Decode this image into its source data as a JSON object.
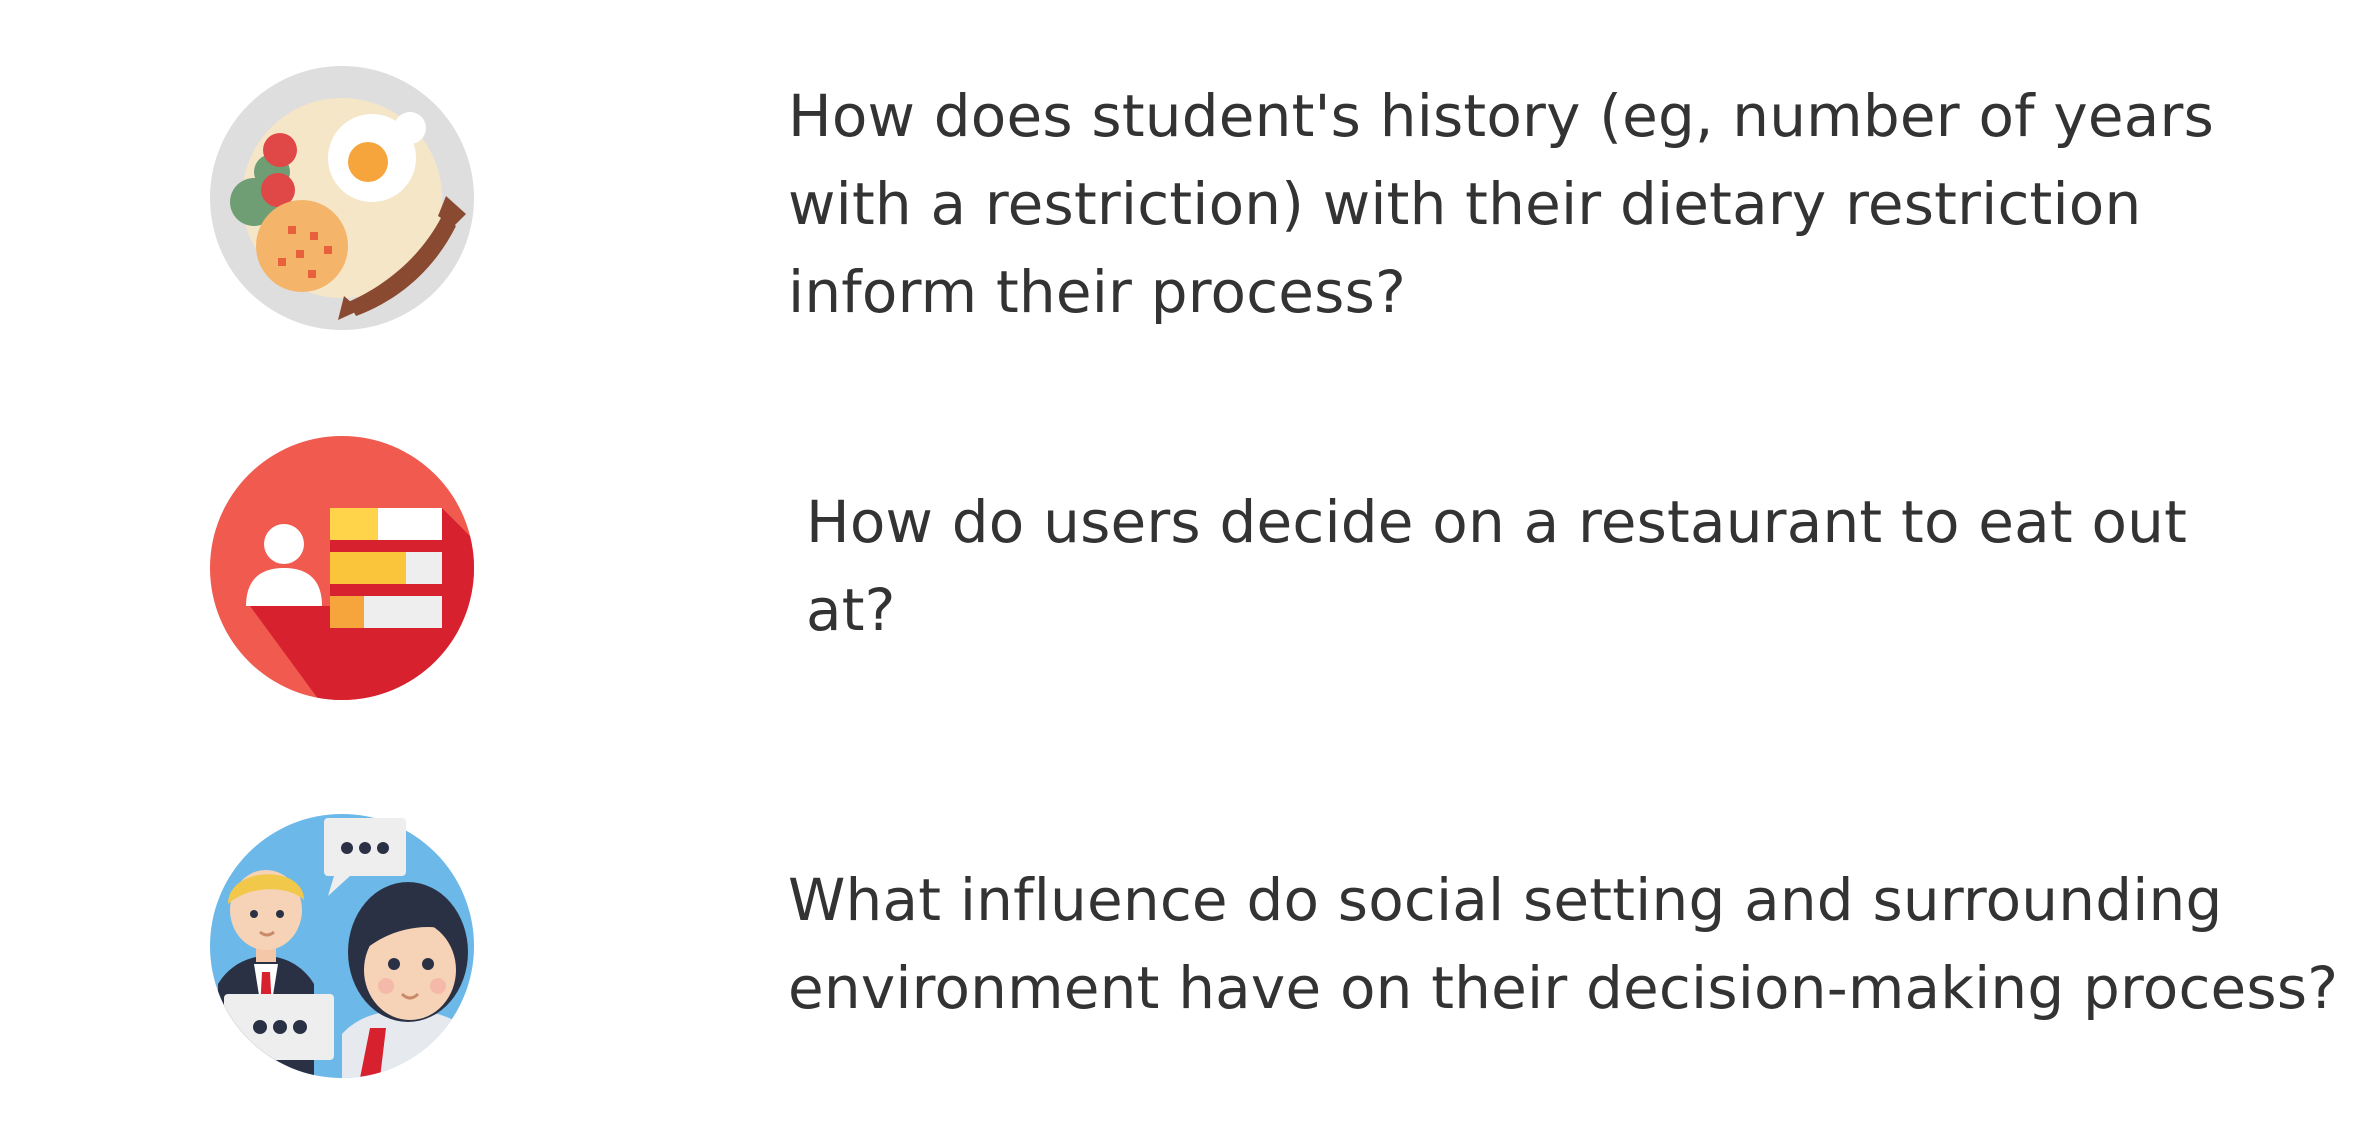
{
  "questions": [
    {
      "icon": "breakfast-plate-icon",
      "lines": [
        "How does student's history (eg, number of years",
        "with a restriction) with their dietary restriction",
        "inform their process?"
      ]
    },
    {
      "icon": "user-profile-list-icon",
      "lines": [
        "How do users decide on a restaurant to eat out",
        "at?"
      ]
    },
    {
      "icon": "people-conversation-icon",
      "lines": [
        "What influence do social setting and surrounding",
        "environment have on their decision-making process?"
      ]
    }
  ],
  "colors": {
    "text": "#333333",
    "plate": "#dcdcdc",
    "profile_red": "#f05a4f",
    "chat_blue": "#6cb8e8"
  }
}
